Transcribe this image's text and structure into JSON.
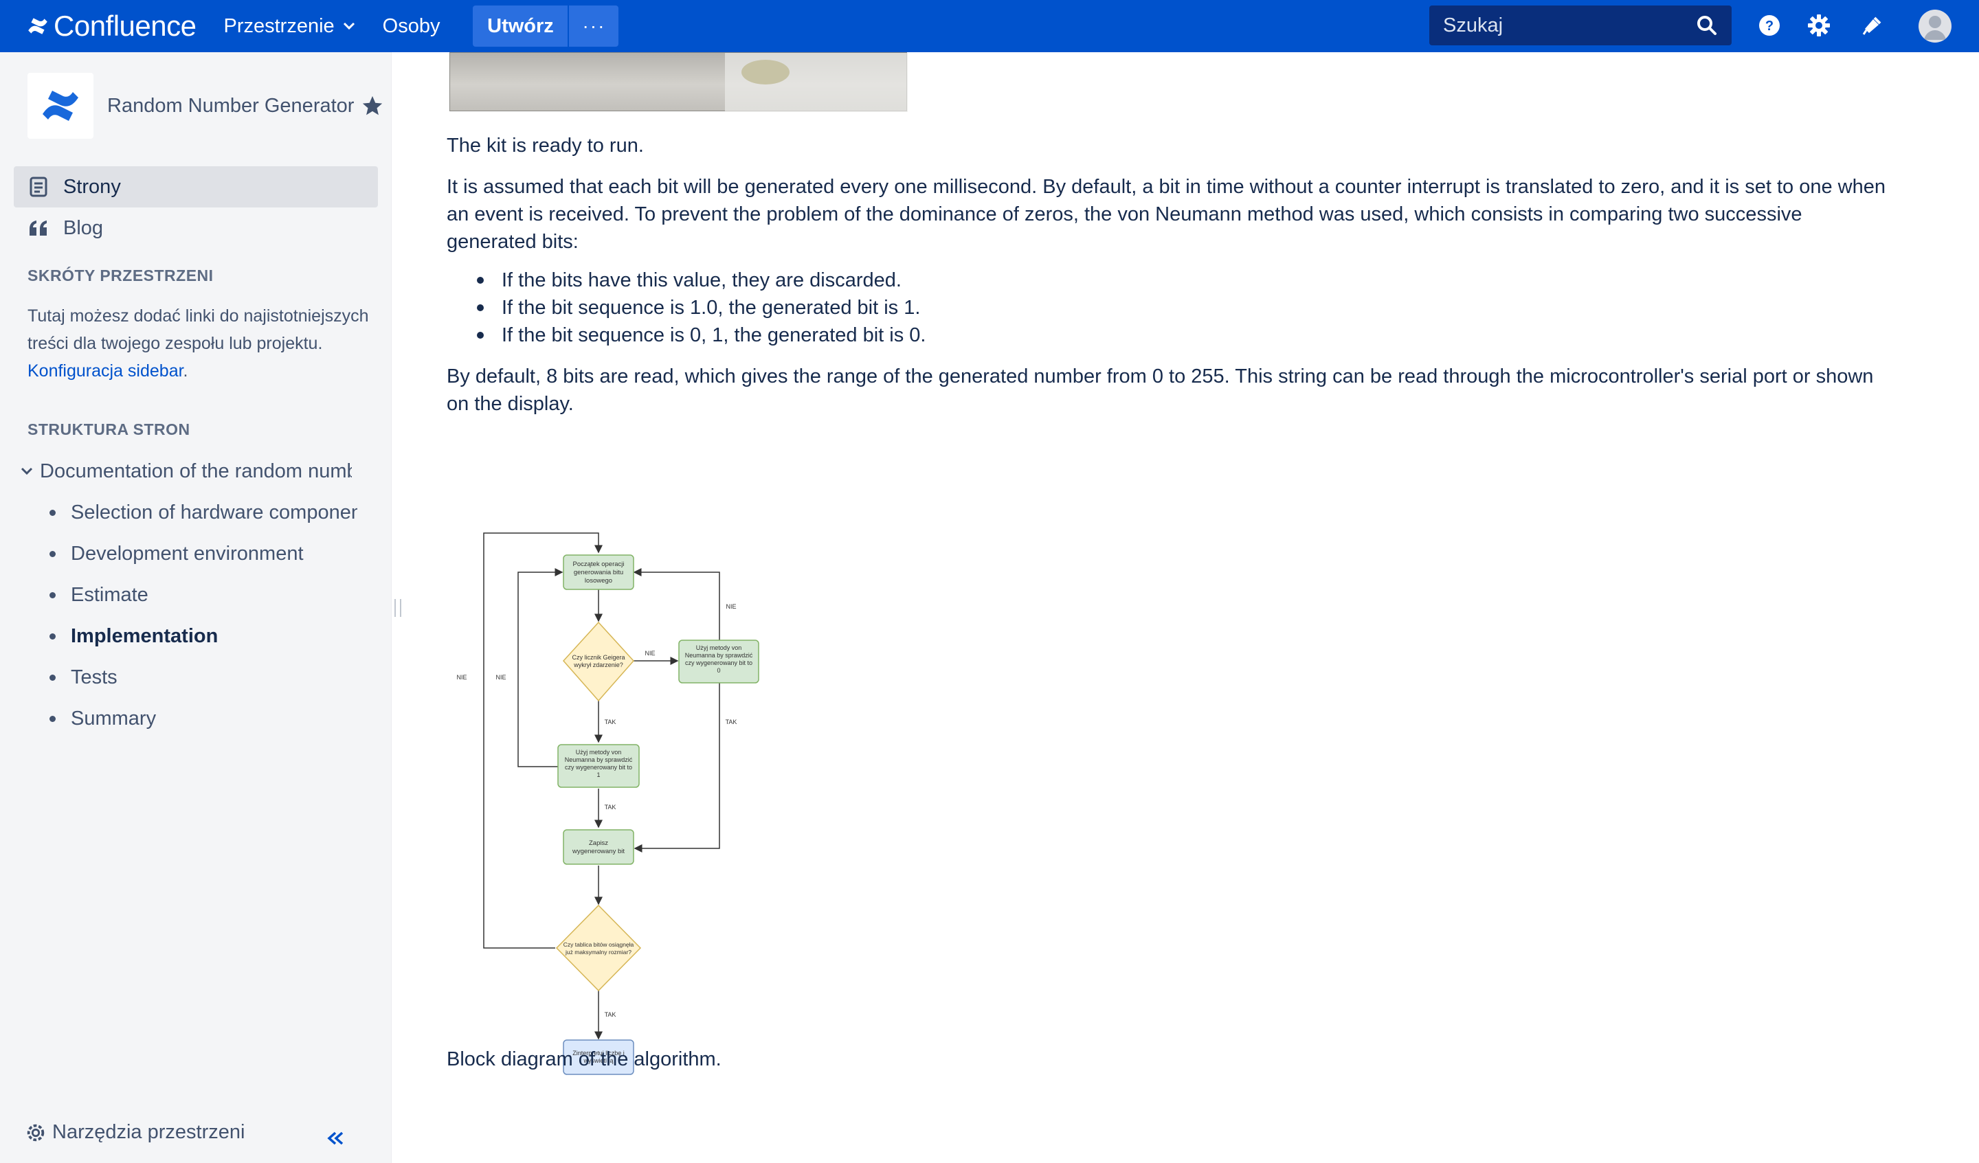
{
  "topnav": {
    "brand": "Confluence",
    "spaces_label": "Przestrzenie",
    "people_label": "Osoby",
    "create_label": "Utwórz",
    "more_label": "···",
    "search_placeholder": "Szukaj",
    "brand_color": "#0052cc"
  },
  "sidebar": {
    "space_name": "Random Number Generator",
    "nav": [
      {
        "label": "Strony",
        "icon": "pages-icon",
        "active": true
      },
      {
        "label": "Blog",
        "icon": "quote-icon",
        "active": false
      }
    ],
    "shortcuts_heading": "SKRÓTY PRZESTRZENI",
    "shortcuts_text": "Tutaj możesz dodać linki do najistotniejszych treści dla twojego zespołu lub projektu.",
    "shortcuts_link": "Konfiguracja sidebar",
    "tree_heading": "STRUKTURA STRON",
    "tree_root": "Documentation of the random number generator",
    "tree_children": [
      {
        "label": "Selection of hardware components",
        "current": false
      },
      {
        "label": "Development environment",
        "current": false
      },
      {
        "label": "Estimate",
        "current": false
      },
      {
        "label": "Implementation",
        "current": true
      },
      {
        "label": "Tests",
        "current": false
      },
      {
        "label": "Summary",
        "current": false
      }
    ],
    "tools_label": "Narzędzia przestrzeni"
  },
  "content": {
    "p1": "The kit is ready to run.",
    "p2": "It is assumed that each bit will be generated every one millisecond. By default, a bit in time without a counter interrupt is translated to zero, and it is set to one when an event is received. To prevent the problem of the dominance of zeros, the von Neumann method was used, which consists in comparing two successive generated bits:",
    "bullets": [
      "If the bits have this value, they are discarded.",
      "If the bit sequence is 1.0, the generated bit is 1.",
      "If the bit sequence is 0, 1, the generated bit is 0."
    ],
    "p3": "By default, 8 bits are read, which gives the range of the generated number from 0 to 255. This string can be read through the microcontroller's serial port or shown on the display.",
    "caption": "Block diagram of the algorithm."
  },
  "diagram": {
    "start": [
      "Początek operacji",
      "generowania bitu",
      "losowego"
    ],
    "decision1": [
      "Czy licznik Geigera",
      "wykrył zdarzenie?"
    ],
    "vn0": [
      "Użyj metody von",
      "Neumanna by sprawdzić",
      "czy wygenerowany bit to",
      "0"
    ],
    "vn1": [
      "Użyj metody von",
      "Neumanna by sprawdzić",
      "czy wygenerowany bit to",
      "1"
    ],
    "save": [
      "Zapisz",
      "wygenerowany bit"
    ],
    "decision2": [
      "Czy tablica bitów osiągnęła",
      "już maksymalny rozmiar?"
    ],
    "end": [
      "Zinterpretuj liczbę i",
      "wyświetl ją"
    ],
    "yes": "TAK",
    "no": "NIE"
  }
}
